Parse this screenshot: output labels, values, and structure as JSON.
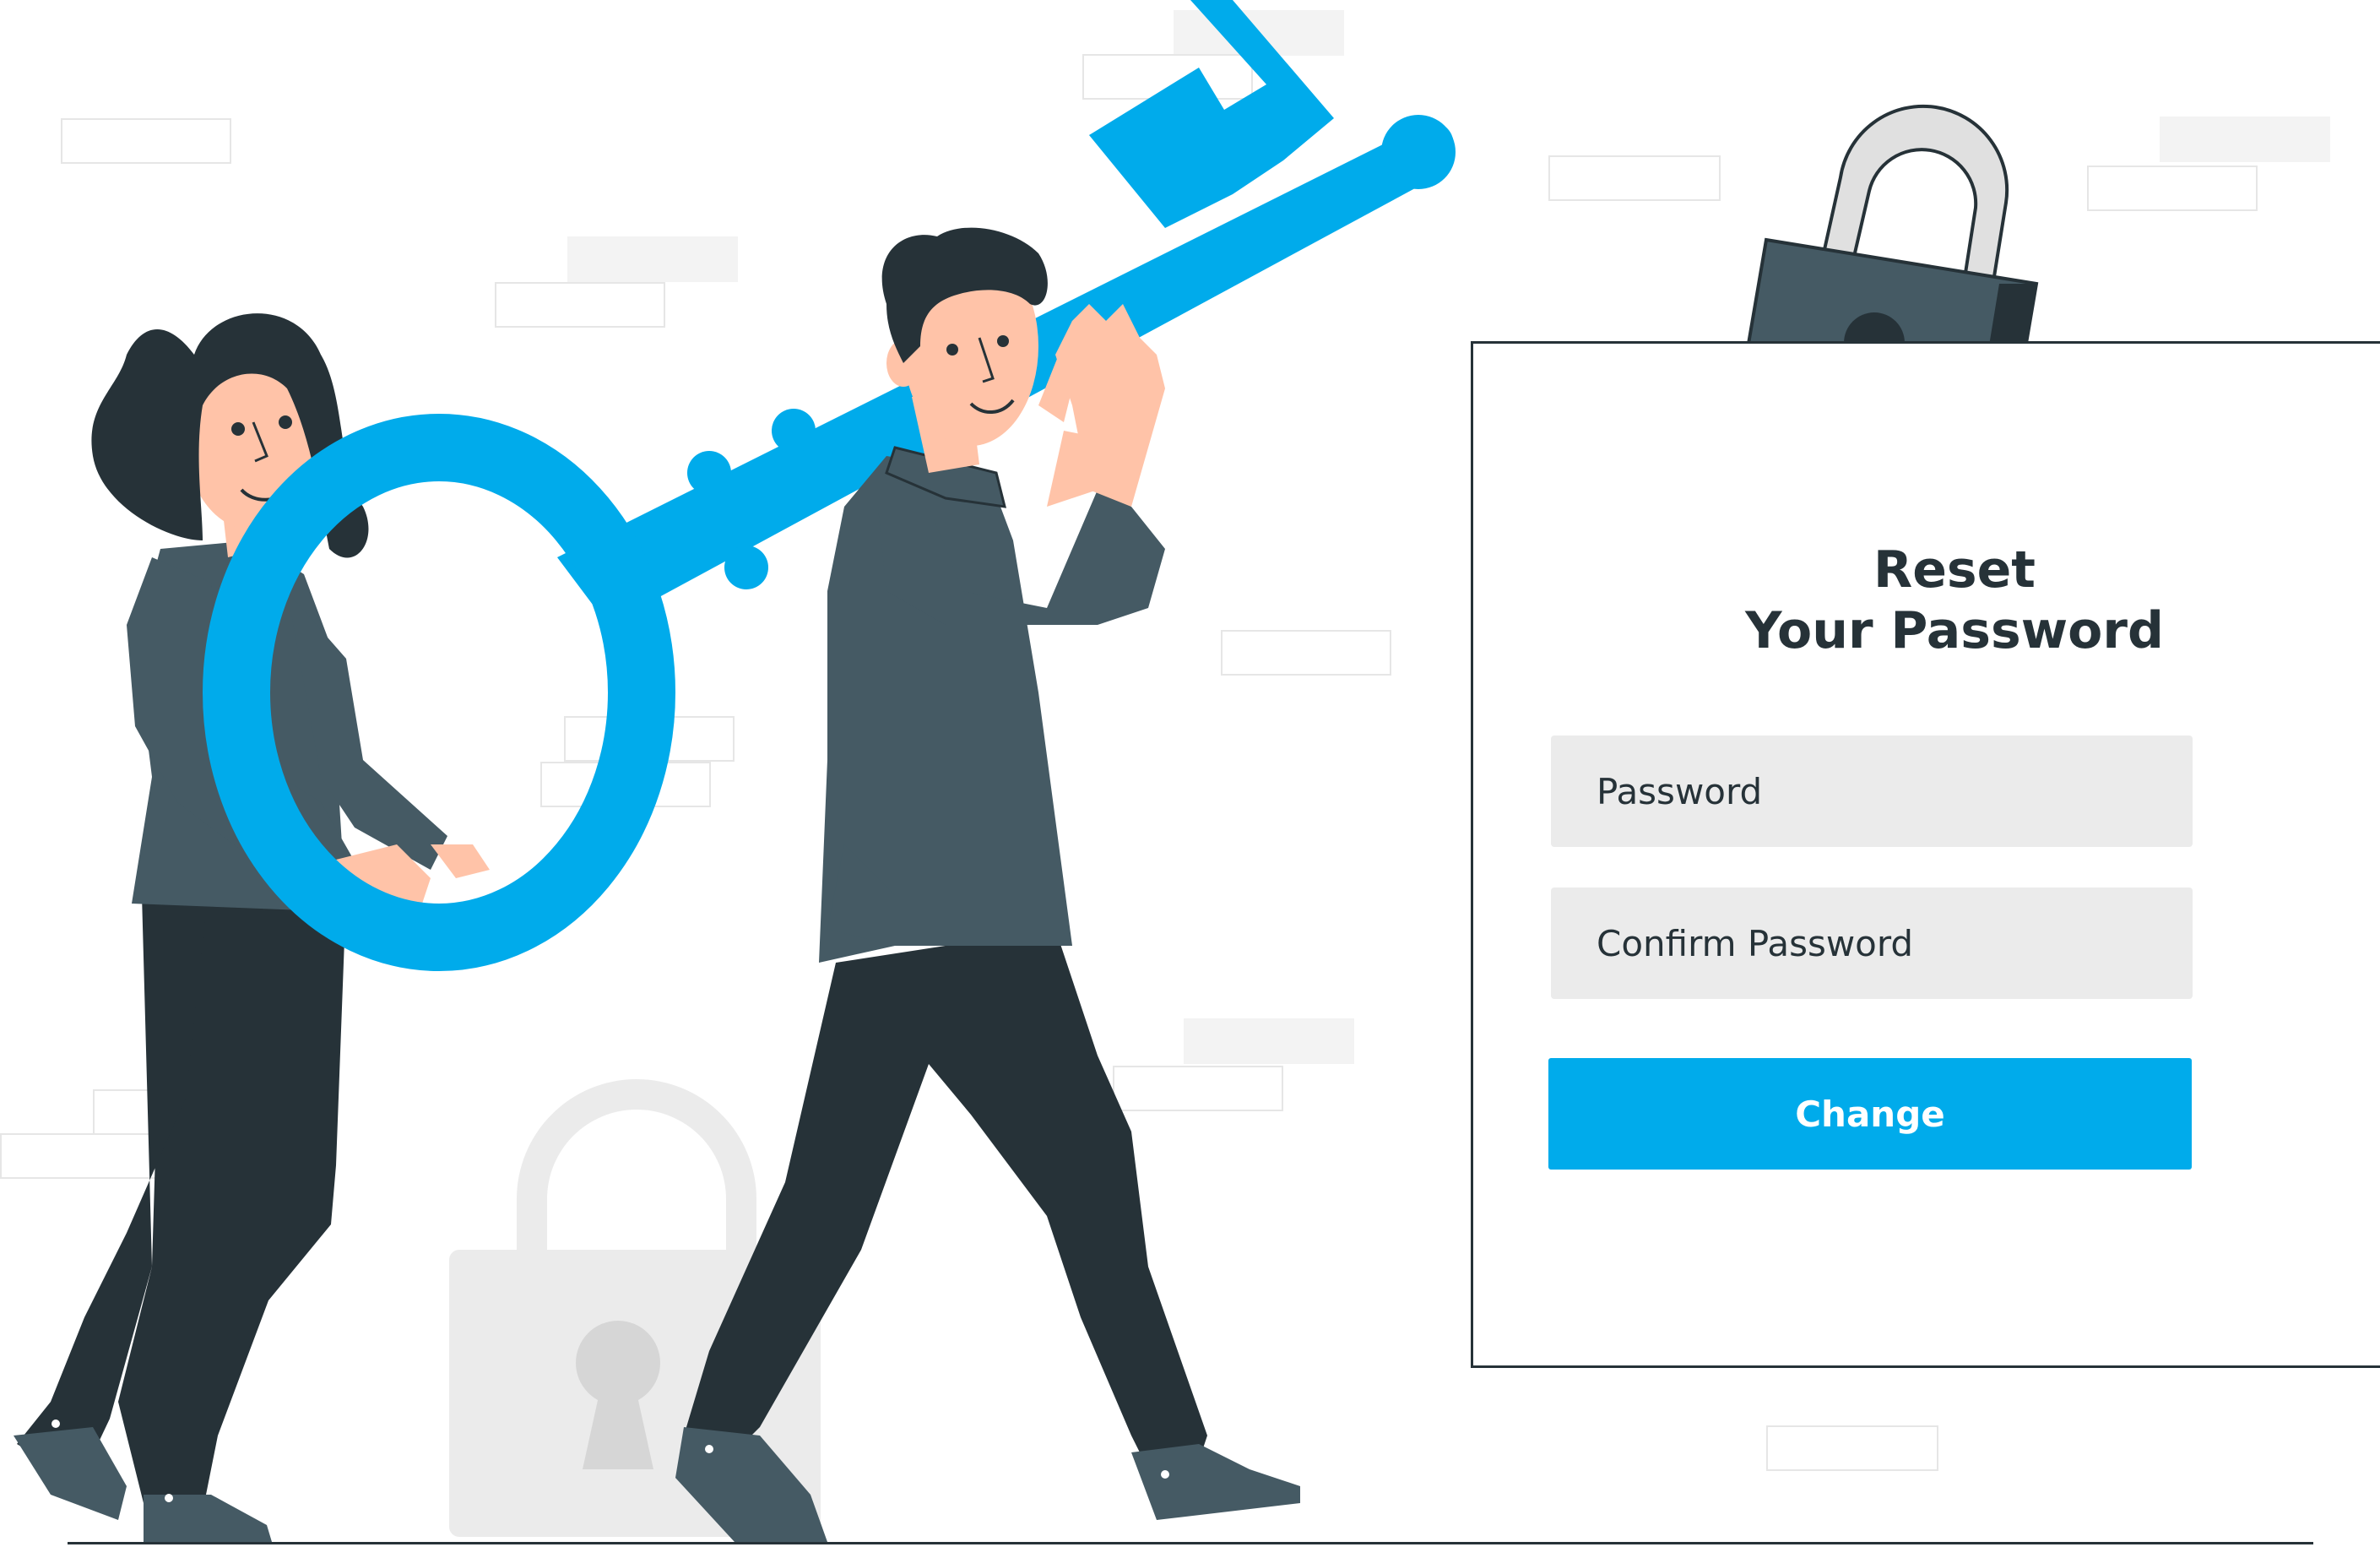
{
  "form": {
    "title_line1": "Reset",
    "title_line2": "Your Password",
    "password_placeholder": "Password",
    "confirm_placeholder": "Confirm Password",
    "submit_label": "Change"
  },
  "colors": {
    "accent": "#00abeb",
    "dark": "#263238",
    "shirt": "#455a64",
    "field": "#ebebeb",
    "skin": "#ffc3a8",
    "ghost_lock": "#ebebeb"
  },
  "icons": {
    "padlock": "padlock-icon",
    "key": "key-illustration"
  }
}
